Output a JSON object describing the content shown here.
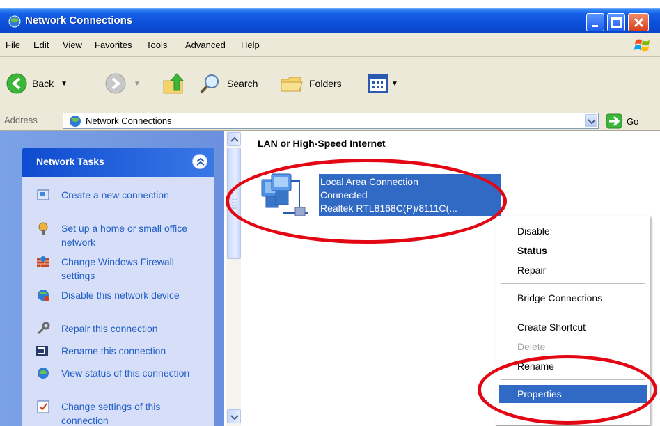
{
  "window": {
    "title": "Network Connections"
  },
  "menubar": {
    "items": [
      "File",
      "Edit",
      "View",
      "Favorites",
      "Tools",
      "Advanced",
      "Help"
    ]
  },
  "toolbar": {
    "back": "Back",
    "search": "Search",
    "folders": "Folders"
  },
  "address": {
    "label": "Address",
    "value": "Network Connections",
    "go": "Go"
  },
  "tasks": {
    "header": "Network Tasks",
    "items": [
      "Create a new connection",
      "Set up a home or small office network",
      "Change Windows Firewall settings",
      "Disable this network device",
      "Repair this connection",
      "Rename this connection",
      "View status of this connection",
      "Change settings of this connection"
    ]
  },
  "main": {
    "group": "LAN or High-Speed Internet",
    "connection": {
      "name": "Local Area Connection",
      "status": "Connected",
      "device": "Realtek RTL8168C(P)/8111C(..."
    }
  },
  "context_menu": {
    "disable": "Disable",
    "status": "Status",
    "repair": "Repair",
    "bridge": "Bridge Connections",
    "shortcut": "Create Shortcut",
    "delete": "Delete",
    "rename": "Rename",
    "properties": "Properties"
  },
  "colors": {
    "titlebar": "#0b4fd8",
    "selection": "#316ac5",
    "annotation": "#e30613",
    "task_link": "#215dc6"
  }
}
